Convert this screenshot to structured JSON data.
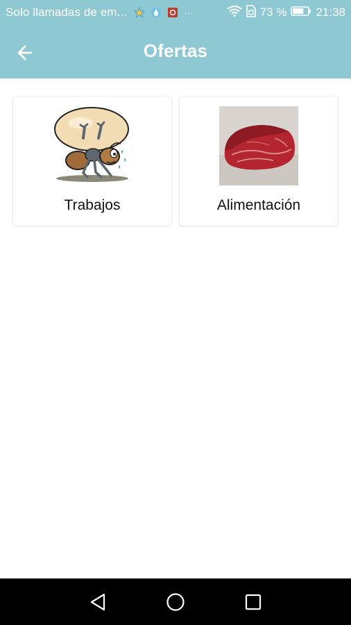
{
  "status_bar": {
    "carrier_text": "Solo llamadas de em...",
    "overflow_dots": "···",
    "battery_percent": "73 %",
    "time": "21:38",
    "notification_icons": [
      "star-app-icon",
      "water-drop-app-icon",
      "red-app-icon"
    ],
    "system_icons": [
      "wifi-icon",
      "sim-icon",
      "battery-icon"
    ],
    "battery_level": 0.73
  },
  "app_bar": {
    "title": "Ofertas",
    "back_icon": "arrow-back-icon",
    "color": "#8ec9d3"
  },
  "categories": [
    {
      "label": "Trabajos",
      "image": "ant-carrying-load-illustration"
    },
    {
      "label": "Alimentación",
      "image": "raw-beef-photo"
    }
  ],
  "nav_bar": {
    "buttons": [
      "back-triangle-icon",
      "home-circle-icon",
      "recents-square-icon"
    ]
  }
}
